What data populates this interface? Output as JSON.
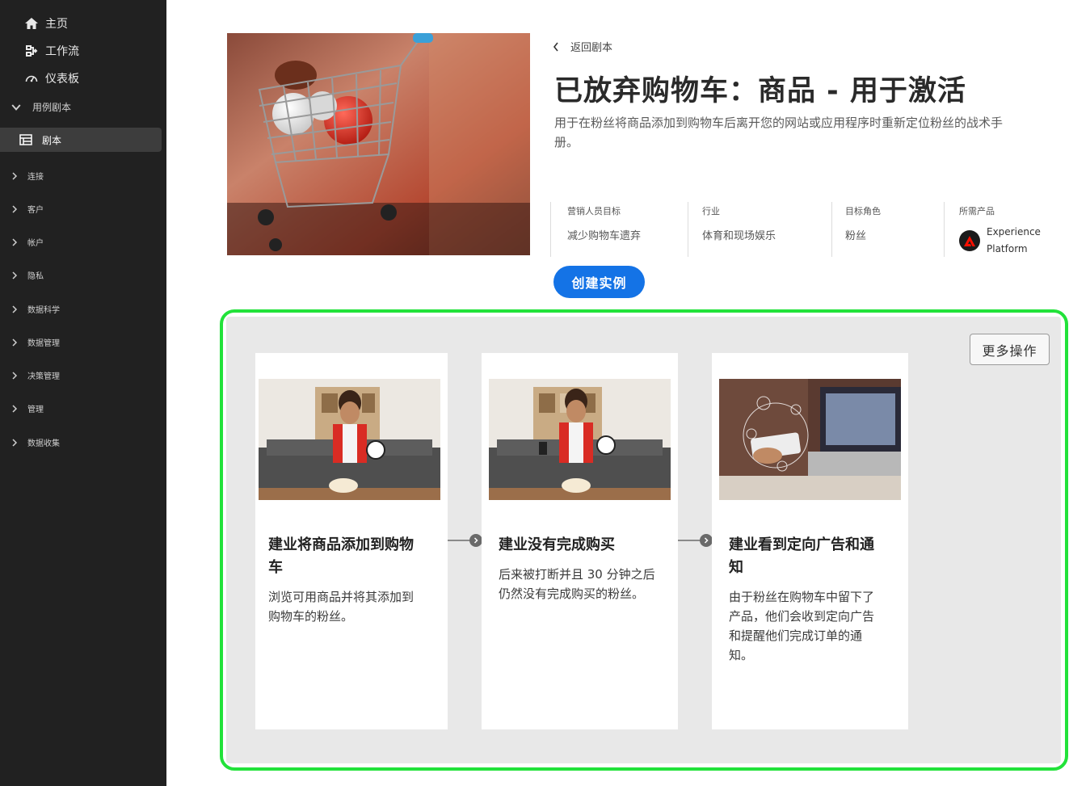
{
  "sidebar": {
    "home": "主页",
    "workflows": "工作流",
    "dashboards": "仪表板",
    "use_case_playbooks": "用例剧本",
    "playbooks": "剧本",
    "sections": [
      "连接",
      "客户",
      "帐户",
      "隐私",
      "数据科学",
      "数据管理",
      "决策管理",
      "管理",
      "数据收集"
    ]
  },
  "header": {
    "back_label": "返回剧本",
    "title": "已放弃购物车：商品 - 用于激活",
    "description": "用于在粉丝将商品添加到购物车后离开您的网站或应用程序时重新定位粉丝的战术手册。"
  },
  "meta": {
    "goal_label": "营销人员目标",
    "goal_value": "减少购物车遗弃",
    "industry_label": "行业",
    "industry_value": "体育和现场娱乐",
    "role_label": "目标角色",
    "role_value": "粉丝",
    "product_label": "所需产品",
    "product_line1": "Experience",
    "product_line2": "Platform"
  },
  "actions": {
    "create_instance": "创建实例",
    "more_actions": "更多操作"
  },
  "journey": [
    {
      "title_line1": "建业将商品添加到购物",
      "title_line2": "车",
      "text_line1": "浏览可用商品并将其添加到",
      "text_line2": "购物车的粉丝。"
    },
    {
      "title_line1": "建业没有完成购买",
      "text_line1": "后来被打断并且 30 分钟之后",
      "text_line2": "仍然没有完成购买的粉丝。"
    },
    {
      "title_line1": "建业看到定向广告和通",
      "title_line2": "知",
      "text_line1": "由于粉丝在购物车中留下了",
      "text_line2": "产品，他们会收到定向广告",
      "text_line3": "和提醒他们完成订单的通",
      "text_line4": "知。"
    }
  ],
  "colors": {
    "sidebar_bg": "#212121",
    "accent": "#1473e6",
    "highlight": "#22e23a",
    "panel_bg": "#e8e8e8"
  },
  "icons": {
    "home": "home-icon",
    "workflows": "workflow-icon",
    "dashboards": "gauge-icon",
    "playbooks": "list-icon",
    "product": "adobe-logo-icon"
  }
}
